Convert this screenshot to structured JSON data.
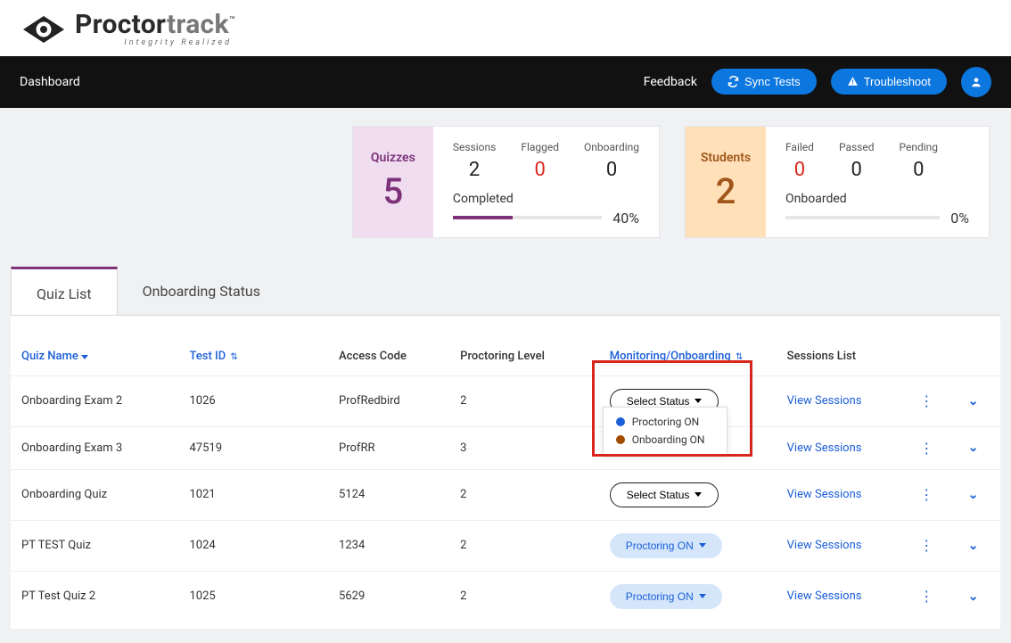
{
  "brand": {
    "name1": "Proctor",
    "name2": "track",
    "tm": "™",
    "tagline": "Integrity Realized"
  },
  "nav": {
    "dashboard": "Dashboard",
    "feedback": "Feedback",
    "sync": "Sync Tests",
    "troubleshoot": "Troubleshoot"
  },
  "stats": {
    "quizzes": {
      "label": "Quizzes",
      "count": "5",
      "sessions": {
        "label": "Sessions",
        "value": "2"
      },
      "flagged": {
        "label": "Flagged",
        "value": "0"
      },
      "onboarding": {
        "label": "Onboarding",
        "value": "0"
      },
      "progress": {
        "label": "Completed",
        "pct": "40%",
        "fill": 40
      }
    },
    "students": {
      "label": "Students",
      "count": "2",
      "failed": {
        "label": "Failed",
        "value": "0"
      },
      "passed": {
        "label": "Passed",
        "value": "0"
      },
      "pending": {
        "label": "Pending",
        "value": "0"
      },
      "progress": {
        "label": "Onboarded",
        "pct": "0%",
        "fill": 0
      }
    }
  },
  "tabs": {
    "quiz_list": "Quiz List",
    "onboarding_status": "Onboarding Status"
  },
  "columns": {
    "quiz_name": "Quiz Name",
    "test_id": "Test ID",
    "access_code": "Access Code",
    "proctoring_level": "Proctoring Level",
    "monitoring": "Monitoring/Onboarding",
    "sessions_list": "Sessions List"
  },
  "status_labels": {
    "select": "Select Status",
    "proctoring_on": "Proctoring ON",
    "onboarding_on": "Onboarding ON"
  },
  "view_sessions": "View Sessions",
  "rows": [
    {
      "name": "Onboarding Exam 2",
      "test_id": "1026",
      "access": "ProfRedbird",
      "level": "2",
      "status": "select",
      "dropdown": true
    },
    {
      "name": "Onboarding Exam 3",
      "test_id": "47519",
      "access": "ProfRR",
      "level": "3",
      "status": "none"
    },
    {
      "name": "Onboarding Quiz",
      "test_id": "1021",
      "access": "5124",
      "level": "2",
      "status": "select"
    },
    {
      "name": "PT TEST Quiz",
      "test_id": "1024",
      "access": "1234",
      "level": "2",
      "status": "proctoring_on"
    },
    {
      "name": "PT Test Quiz 2",
      "test_id": "1025",
      "access": "5629",
      "level": "2",
      "status": "proctoring_on"
    }
  ]
}
